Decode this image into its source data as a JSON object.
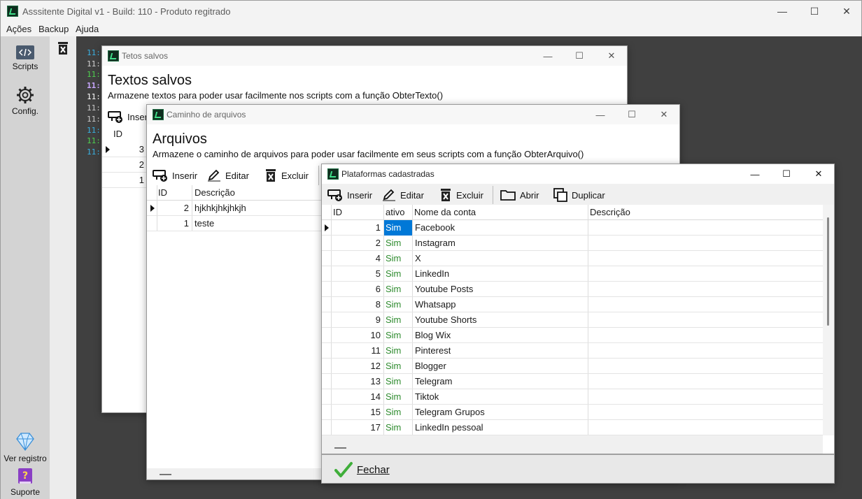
{
  "app": {
    "title": "Asssitente Digital v1 - Build: 110 - Produto regitrado",
    "menu": [
      "Ações",
      "Backup",
      "Ajuda"
    ]
  },
  "sidebar": {
    "scripts_label": "Scripts",
    "config_label": "Config.",
    "registro_label": "Ver registro",
    "suporte_label": "Suporte"
  },
  "log": {
    "lines": [
      {
        "text": "11:",
        "color": "#3ab0e0"
      },
      {
        "text": "11:",
        "color": "#d0d0d0"
      },
      {
        "text": "11:",
        "color": "#4fd04f"
      },
      {
        "text": "11:",
        "color": "#c9a8ff"
      },
      {
        "text": "11:",
        "color": "#ffffff"
      },
      {
        "text": "11:",
        "color": "#c8c8c8"
      },
      {
        "text": "11:",
        "color": "#c8c8c8"
      },
      {
        "text": "11:",
        "color": "#3ab0e0"
      },
      {
        "text": "11:",
        "color": "#4fd04f"
      },
      {
        "text": "11:",
        "color": "#3ab0e0"
      }
    ]
  },
  "win_textos": {
    "title": "Tetos salvos",
    "heading": "Textos salvos",
    "subtitle": "Armazene textos para poder usar facilmente nos scripts com a função ObterTexto()",
    "insert_label": "Inseri",
    "col_id": "ID",
    "ids": [
      "3",
      "2",
      "1"
    ]
  },
  "win_arquivos": {
    "title": "Caminho de arquivos",
    "heading": "Arquivos",
    "subtitle": "Armazene o caminho de arquivos para poder usar facilmente em seus scripts com a função ObterArquivo()",
    "insert_label": "Inserir",
    "edit_label": "Editar",
    "delete_label": "Excluir",
    "col_id": "ID",
    "col_desc": "Descrição",
    "rows": [
      {
        "id": "2",
        "desc": "hjkhkjhkjhkjh"
      },
      {
        "id": "1",
        "desc": "teste"
      }
    ]
  },
  "win_plataformas": {
    "title": "Plataformas cadastradas",
    "insert_label": "Inserir",
    "edit_label": "Editar",
    "delete_label": "Excluir",
    "open_label": "Abrir",
    "duplicate_label": "Duplicar",
    "col_id": "ID",
    "col_ativo": "ativo",
    "col_nome": "Nome da conta",
    "col_desc": "Descrição",
    "close_label": "Fechar",
    "rows": [
      {
        "id": "1",
        "ativo": "Sim",
        "nome": "Facebook",
        "desc": ""
      },
      {
        "id": "2",
        "ativo": "Sim",
        "nome": "Instagram",
        "desc": ""
      },
      {
        "id": "4",
        "ativo": "Sim",
        "nome": "X",
        "desc": ""
      },
      {
        "id": "5",
        "ativo": "Sim",
        "nome": "LinkedIn",
        "desc": ""
      },
      {
        "id": "6",
        "ativo": "Sim",
        "nome": "Youtube Posts",
        "desc": ""
      },
      {
        "id": "8",
        "ativo": "Sim",
        "nome": "Whatsapp",
        "desc": ""
      },
      {
        "id": "9",
        "ativo": "Sim",
        "nome": "Youtube Shorts",
        "desc": ""
      },
      {
        "id": "10",
        "ativo": "Sim",
        "nome": "Blog Wix",
        "desc": ""
      },
      {
        "id": "11",
        "ativo": "Sim",
        "nome": "Pinterest",
        "desc": ""
      },
      {
        "id": "12",
        "ativo": "Sim",
        "nome": "Blogger",
        "desc": ""
      },
      {
        "id": "13",
        "ativo": "Sim",
        "nome": "Telegram",
        "desc": ""
      },
      {
        "id": "14",
        "ativo": "Sim",
        "nome": "Tiktok",
        "desc": ""
      },
      {
        "id": "15",
        "ativo": "Sim",
        "nome": "Telegram Grupos",
        "desc": ""
      },
      {
        "id": "17",
        "ativo": "Sim",
        "nome": "LinkedIn pessoal",
        "desc": ""
      }
    ]
  },
  "colors": {
    "selection": "#0078d7",
    "active_text": "#2e8b2e",
    "console_bg": "#404040",
    "sidebar_bg": "#d3d3d3"
  }
}
